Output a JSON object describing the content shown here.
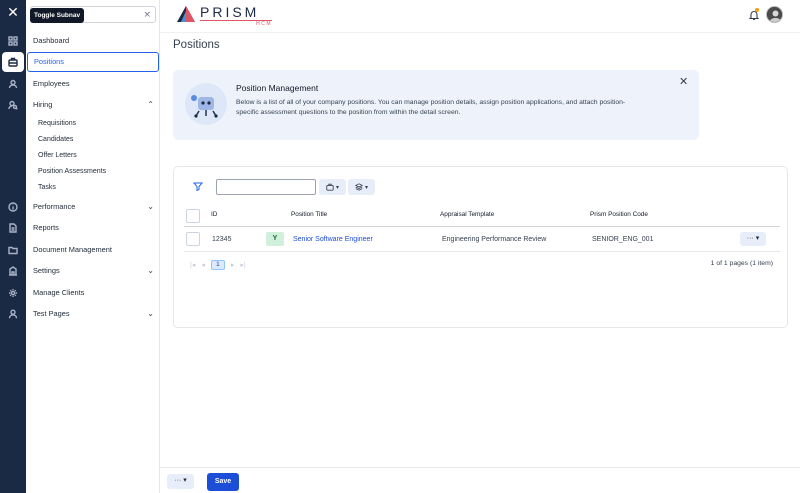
{
  "tooltip": "Toggle Subnav",
  "rail": {
    "close_glyph": "✕",
    "icons": [
      "dashboard-icon",
      "briefcase-icon",
      "user-icon",
      "user-search-icon",
      "info-icon",
      "document-icon",
      "folder-icon",
      "building-icon",
      "gear-icon",
      "person-icon"
    ]
  },
  "subnav": {
    "search_value": "",
    "clear_glyph": "×",
    "items": {
      "dashboard": "Dashboard",
      "positions": "Positions",
      "employees": "Employees",
      "hiring": "Hiring",
      "requisitions": "Requisitions",
      "candidates": "Candidates",
      "offer_letters": "Offer Letters",
      "position_assessments": "Position Assessments",
      "tasks": "Tasks",
      "performance": "Performance",
      "reports": "Reports",
      "document_management": "Document Management",
      "settings": "Settings",
      "manage_clients": "Manage Clients",
      "test_pages": "Test Pages"
    },
    "chevron_up": "⌃",
    "chevron_down": "⌄"
  },
  "header": {
    "logo_text": "PRISM",
    "logo_sub": "HCM"
  },
  "page": {
    "title": "Positions"
  },
  "banner": {
    "title": "Position Management",
    "description": "Below is a list of all of your company positions. You can manage position details, assign position applications, and attach position-specific assessment questions to the position from within the detail screen.",
    "close_glyph": "✕"
  },
  "table": {
    "search_value": "",
    "headers": {
      "id": "ID",
      "title": "Position Title",
      "template": "Appraisal Template",
      "code": "Prism Position Code"
    },
    "rows": [
      {
        "id": "12345",
        "status": "Y",
        "title": "Senior Software Engineer",
        "template": "Engineering Performance Review",
        "code": "SENIOR_ENG_001",
        "menu": "··· ▾"
      }
    ],
    "pager": {
      "first": "|◂",
      "prev": "◂",
      "page": "1",
      "next": "▸",
      "last": "▸|",
      "info": "1 of 1 pages (1 item)"
    },
    "dd_caret": "▾"
  },
  "footer": {
    "more_label": "··· ▾",
    "save_label": "Save"
  },
  "colors": {
    "rail_bg": "#1b2a44",
    "accent": "#1d4ed8",
    "banner_bg": "#eef3fb",
    "logo_accent": "#e05565"
  }
}
